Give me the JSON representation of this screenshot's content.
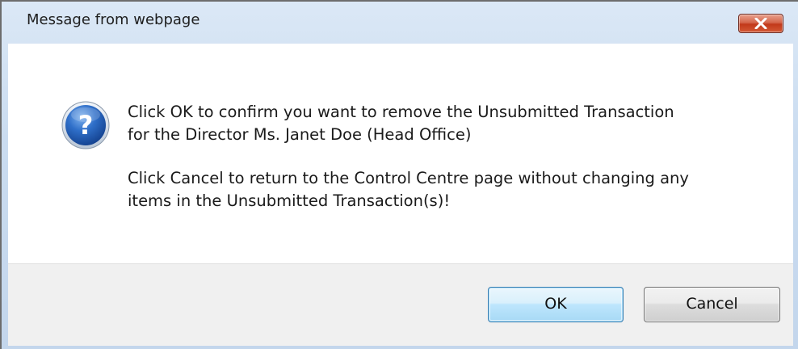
{
  "dialog": {
    "title": "Message from webpage",
    "icon": "question-icon",
    "close_icon": "close-icon",
    "message_line_1": "Click OK to confirm you want to remove the Unsubmitted Transaction\nfor the Director Ms. Janet Doe (Head Office)",
    "message_line_2": "Click Cancel to return to the Control Centre page without changing any\nitems in the Unsubmitted Transaction(s)!",
    "ok_label": "OK",
    "cancel_label": "Cancel"
  },
  "colors": {
    "close_button": "#c8432a",
    "icon_blue": "#1f5fb8",
    "ok_button_border": "#3c7fb1",
    "button_area": "#f0f0f0",
    "frame": "#cadcf0"
  }
}
